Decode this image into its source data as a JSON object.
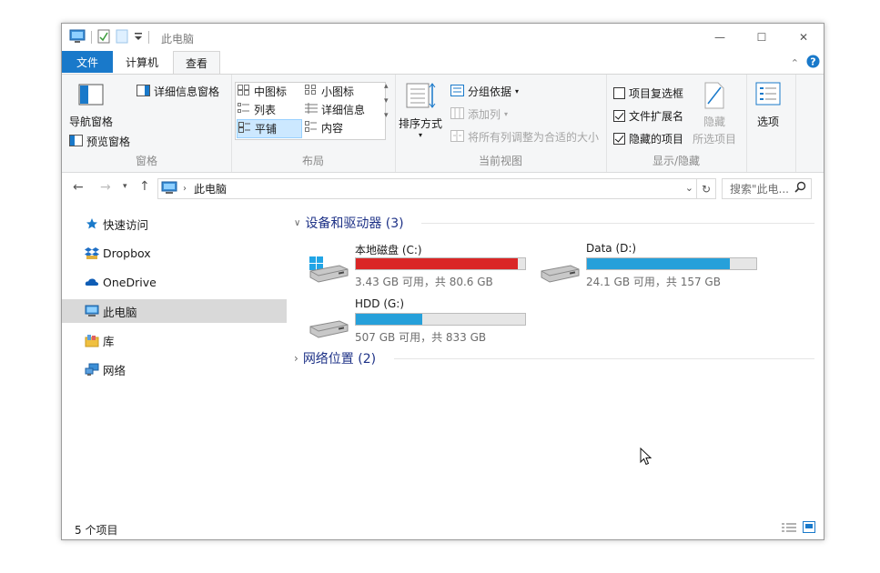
{
  "window": {
    "title": "此电脑",
    "controls": {
      "minimize": "—",
      "maximize": "☐",
      "close": "✕"
    }
  },
  "tabs": {
    "file": "文件",
    "computer": "计算机",
    "view": "查看",
    "active": "查看"
  },
  "ribbon": {
    "panes": {
      "label": "窗格",
      "nav_pane": "导航窗格",
      "preview_pane": "预览窗格",
      "details_pane": "详细信息窗格"
    },
    "layout": {
      "label": "布局",
      "items": [
        "中图标",
        "小图标",
        "列表",
        "详细信息",
        "平铺",
        "内容"
      ],
      "selected": "平铺"
    },
    "current_view": {
      "label": "当前视图",
      "sort_by": "排序方式",
      "group_by": "分组依据",
      "add_columns": "添加列",
      "size_all_columns": "将所有列调整为合适的大小"
    },
    "show_hide": {
      "label": "显示/隐藏",
      "item_checkboxes": "项目复选框",
      "item_checkboxes_checked": false,
      "file_extensions": "文件扩展名",
      "file_extensions_checked": true,
      "hidden_items": "隐藏的项目",
      "hidden_items_checked": true,
      "hide_selected_1": "隐藏",
      "hide_selected_2": "所选项目",
      "options": "选项"
    }
  },
  "address": {
    "path": "此电脑",
    "search_placeholder": "搜索\"此电..."
  },
  "nav": {
    "items": [
      {
        "label": "快速访问",
        "icon": "star-icon"
      },
      {
        "label": "Dropbox",
        "icon": "dropbox-icon"
      },
      {
        "label": "OneDrive",
        "icon": "cloud-icon"
      },
      {
        "label": "此电脑",
        "icon": "computer-icon",
        "selected": true
      },
      {
        "label": "库",
        "icon": "library-icon"
      },
      {
        "label": "网络",
        "icon": "network-icon"
      }
    ]
  },
  "content": {
    "devices_group": "设备和驱动器 (3)",
    "network_group": "网络位置 (2)",
    "drives": [
      {
        "name": "本地磁盘 (C:)",
        "free": "3.43 GB 可用，共 80.6 GB",
        "used_pct": 95.7,
        "color": "#da2626",
        "icon": "windows-drive-icon"
      },
      {
        "name": "Data (D:)",
        "free": "24.1 GB 可用，共 157 GB",
        "used_pct": 84.6,
        "color": "#26a0da",
        "icon": "drive-icon"
      },
      {
        "name": "HDD (G:)",
        "free": "507 GB 可用，共 833 GB",
        "used_pct": 39.1,
        "color": "#26a0da",
        "icon": "drive-icon"
      }
    ]
  },
  "status": {
    "count": "5 个项目"
  },
  "colors": {
    "accent": "#1979ca",
    "group_header": "#1e3287",
    "selection": "#d9d9d9"
  }
}
